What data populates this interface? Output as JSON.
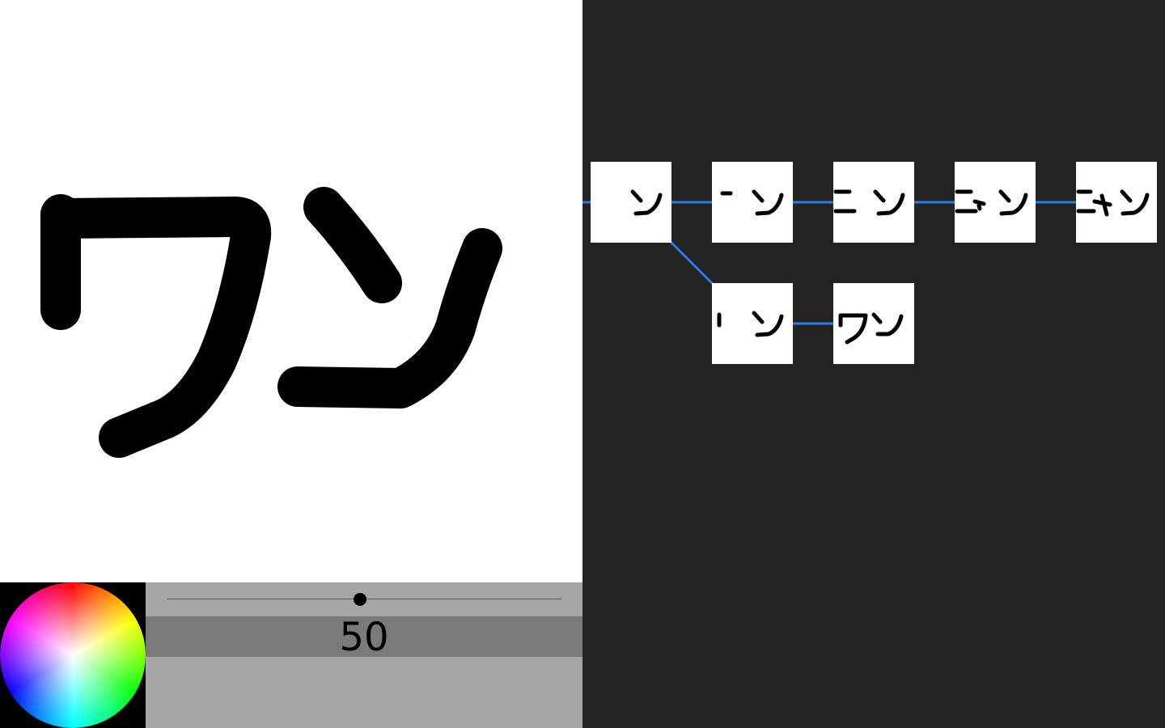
{
  "canvas": {
    "background": "#ffffff",
    "stroke_color": "#000000"
  },
  "color_picker": {
    "icon": "color-wheel-icon",
    "selected_color": "#000000"
  },
  "brush_size": {
    "value_label": "50",
    "slider_fraction": 0.49
  },
  "history": {
    "background": "#232323",
    "link_color": "#2a7de1",
    "current_node": "node-7",
    "nodes": [
      {
        "id": "node-1",
        "snapshot": "ン"
      },
      {
        "id": "node-2",
        "snapshot": "ー ン"
      },
      {
        "id": "node-3",
        "snapshot": "ニ ン"
      },
      {
        "id": "node-4",
        "snapshot": "ニャン"
      },
      {
        "id": "node-5",
        "snapshot": "ニャン"
      },
      {
        "id": "node-6",
        "snapshot": "' ン"
      },
      {
        "id": "node-7",
        "snapshot": "ワン"
      }
    ]
  }
}
